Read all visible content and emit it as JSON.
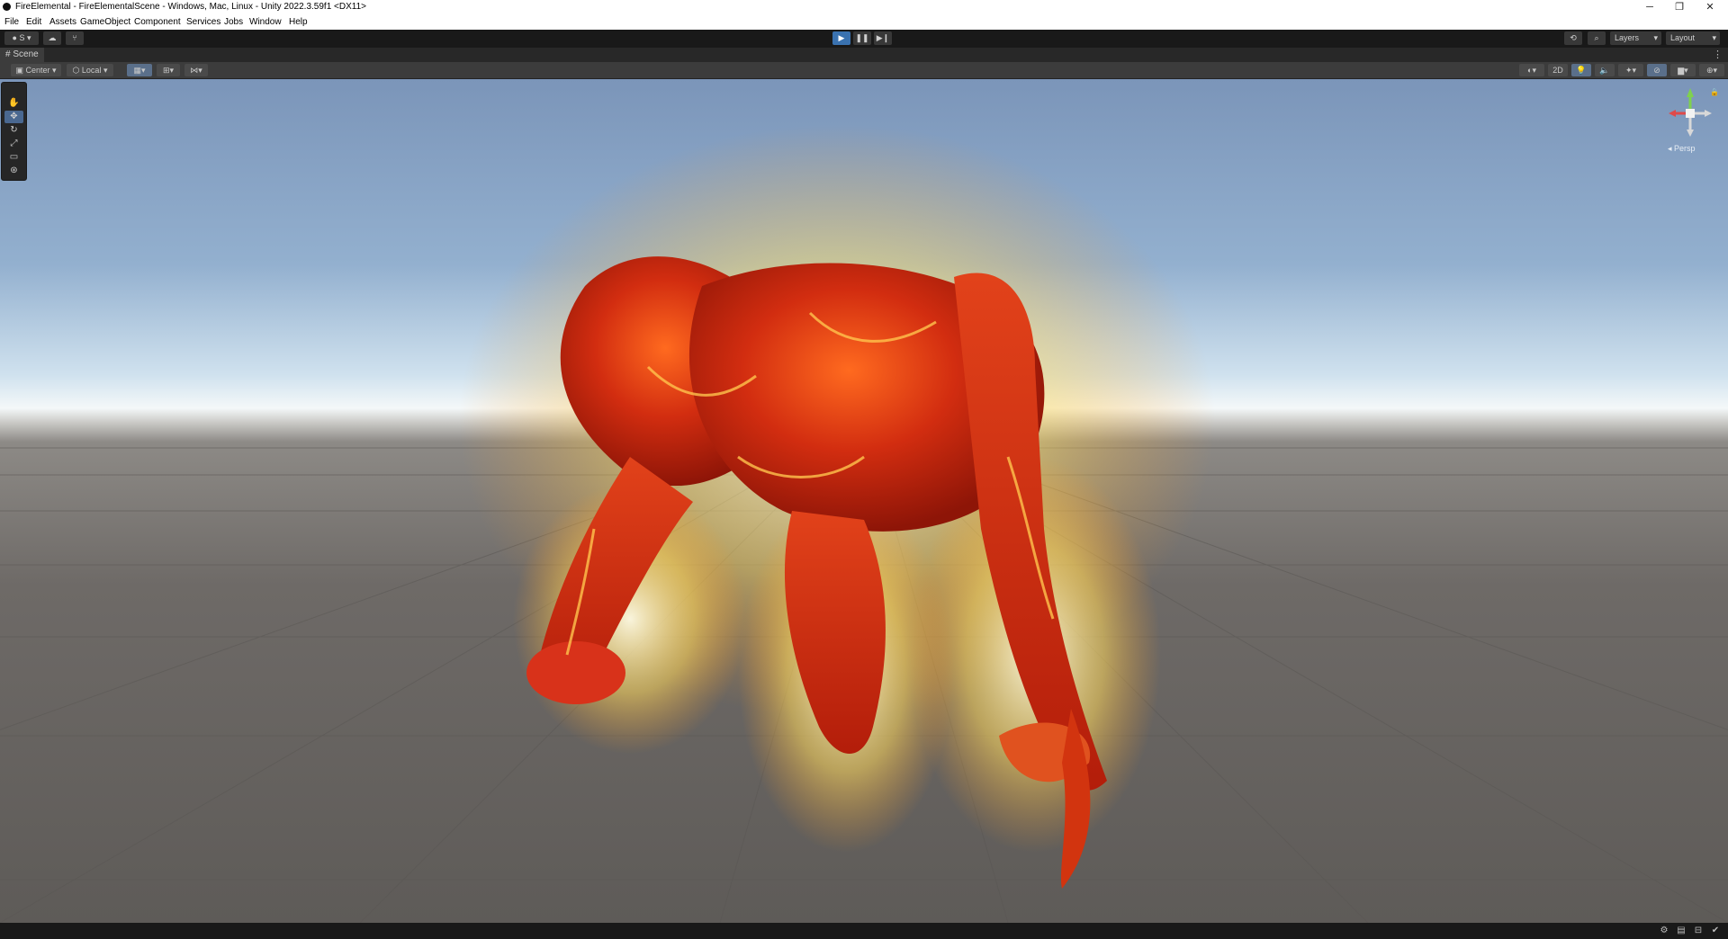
{
  "window": {
    "title": "FireElemental - FireElementalScene - Windows, Mac, Linux - Unity 2022.3.59f1 <DX11>",
    "controls": {
      "minimize": "─",
      "restore": "❐",
      "close": "✕"
    }
  },
  "menu": [
    "File",
    "Edit",
    "Assets",
    "GameObject",
    "Component",
    "Services",
    "Jobs",
    "Window",
    "Help"
  ],
  "toolbar": {
    "account_label": "S",
    "layers_label": "Layers",
    "layout_label": "Layout"
  },
  "scene_tab": {
    "label": "Scene",
    "icon": "grid-hash-icon"
  },
  "scene_toolbar": {
    "pivot_mode": "Center",
    "pivot_rotation": "Local",
    "view_2d": "2D"
  },
  "tools": [
    "hand-icon",
    "move-icon",
    "rotate-icon",
    "scale-icon",
    "rect-icon",
    "transform-icon"
  ],
  "gizmo": {
    "projection_label": "◂ Persp"
  },
  "colors": {
    "accent": "#3a72b0",
    "editor_bg": "#191919",
    "panel": "#3c3c3c",
    "fire_core": "#c8260c",
    "fire_glow": "#ffd24a"
  }
}
